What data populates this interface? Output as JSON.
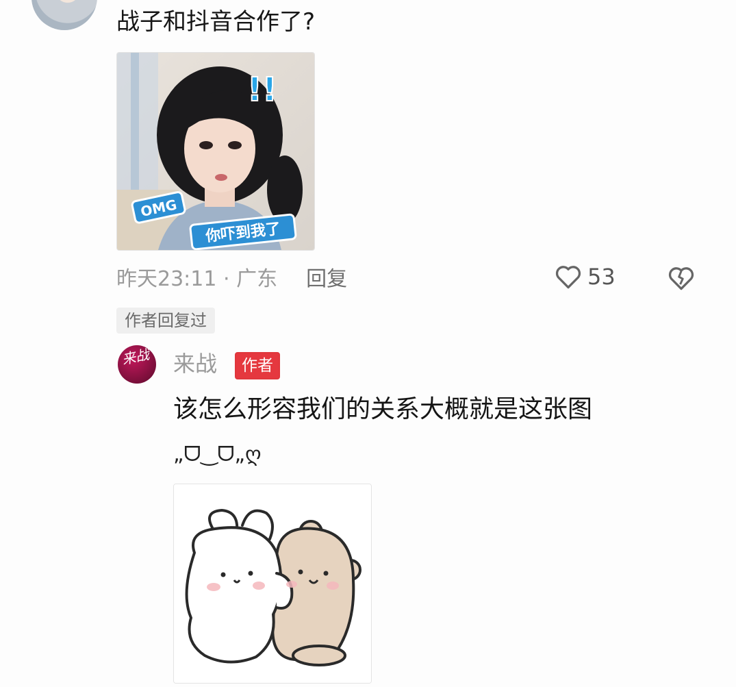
{
  "comment": {
    "text": "战子和抖音合作了?",
    "sticker": {
      "badge_left": "OMG",
      "caption": "你吓到我了",
      "exclaim": "!!"
    },
    "meta": {
      "time_location": "昨天23:11 · 广东",
      "reply_label": "回复"
    },
    "likes": "53",
    "author_replied_tag": "作者回复过"
  },
  "reply": {
    "avatar_text": "来战",
    "name": "来战",
    "badge": "作者",
    "text": "该怎么形容我们的关系大概就是这张图",
    "kaomoji": "„ᗜ‿ᗜ„ღ"
  },
  "colors": {
    "badge_red": "#e5383f",
    "meta_gray": "#9a9a9a"
  }
}
